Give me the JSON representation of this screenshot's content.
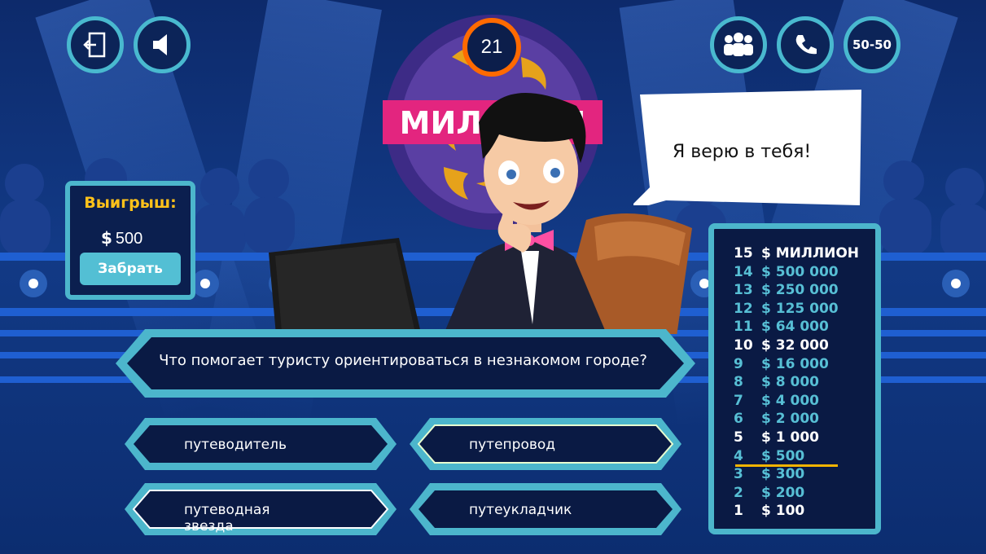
{
  "header": {
    "left_buttons": [
      {
        "icon": "exit-icon"
      },
      {
        "icon": "sound-icon"
      }
    ],
    "lifelines": [
      {
        "icon": "audience-icon"
      },
      {
        "icon": "phone-icon"
      },
      {
        "label": "50-50"
      }
    ]
  },
  "logo": {
    "text": "МИЛЛИОН"
  },
  "timer": {
    "value": "21"
  },
  "host": {
    "speech": "Я верю в тебя!"
  },
  "winnings": {
    "title": "Выигрыш:",
    "currency": "$",
    "amount": "500",
    "take_label": "Забрать"
  },
  "question": {
    "text": "Что помогает туристу ориентироваться в незнакомом городе?"
  },
  "answers": [
    {
      "text": "путеводитель"
    },
    {
      "text": "путепровод"
    },
    {
      "text": "путеводная звезда"
    },
    {
      "text": "путеукладчик"
    }
  ],
  "ladder": {
    "current_level": 4,
    "levels": [
      {
        "n": "15",
        "amount": "$ МИЛЛИОН",
        "safe": true
      },
      {
        "n": "14",
        "amount": "$ 500 000",
        "safe": false
      },
      {
        "n": "13",
        "amount": "$ 250 000",
        "safe": false
      },
      {
        "n": "12",
        "amount": "$ 125 000",
        "safe": false
      },
      {
        "n": "11",
        "amount": "$ 64 000",
        "safe": false
      },
      {
        "n": "10",
        "amount": "$ 32 000",
        "safe": true
      },
      {
        "n": "9",
        "amount": "$ 16 000",
        "safe": false
      },
      {
        "n": "8",
        "amount": "$ 8 000",
        "safe": false
      },
      {
        "n": "7",
        "amount": "$ 4 000",
        "safe": false
      },
      {
        "n": "6",
        "amount": "$ 2 000",
        "safe": false
      },
      {
        "n": "5",
        "amount": "$ 1 000",
        "safe": true
      },
      {
        "n": "4",
        "amount": "$ 500",
        "safe": false
      },
      {
        "n": "3",
        "amount": "$ 300",
        "safe": false
      },
      {
        "n": "2",
        "amount": "$ 200",
        "safe": false
      },
      {
        "n": "1",
        "amount": "$ 100",
        "safe": true
      }
    ]
  },
  "colors": {
    "accent": "#4cb6cc",
    "gold": "#ffc21a",
    "timer_ring": "#ff6a00",
    "logo_pink": "#e3257f"
  }
}
